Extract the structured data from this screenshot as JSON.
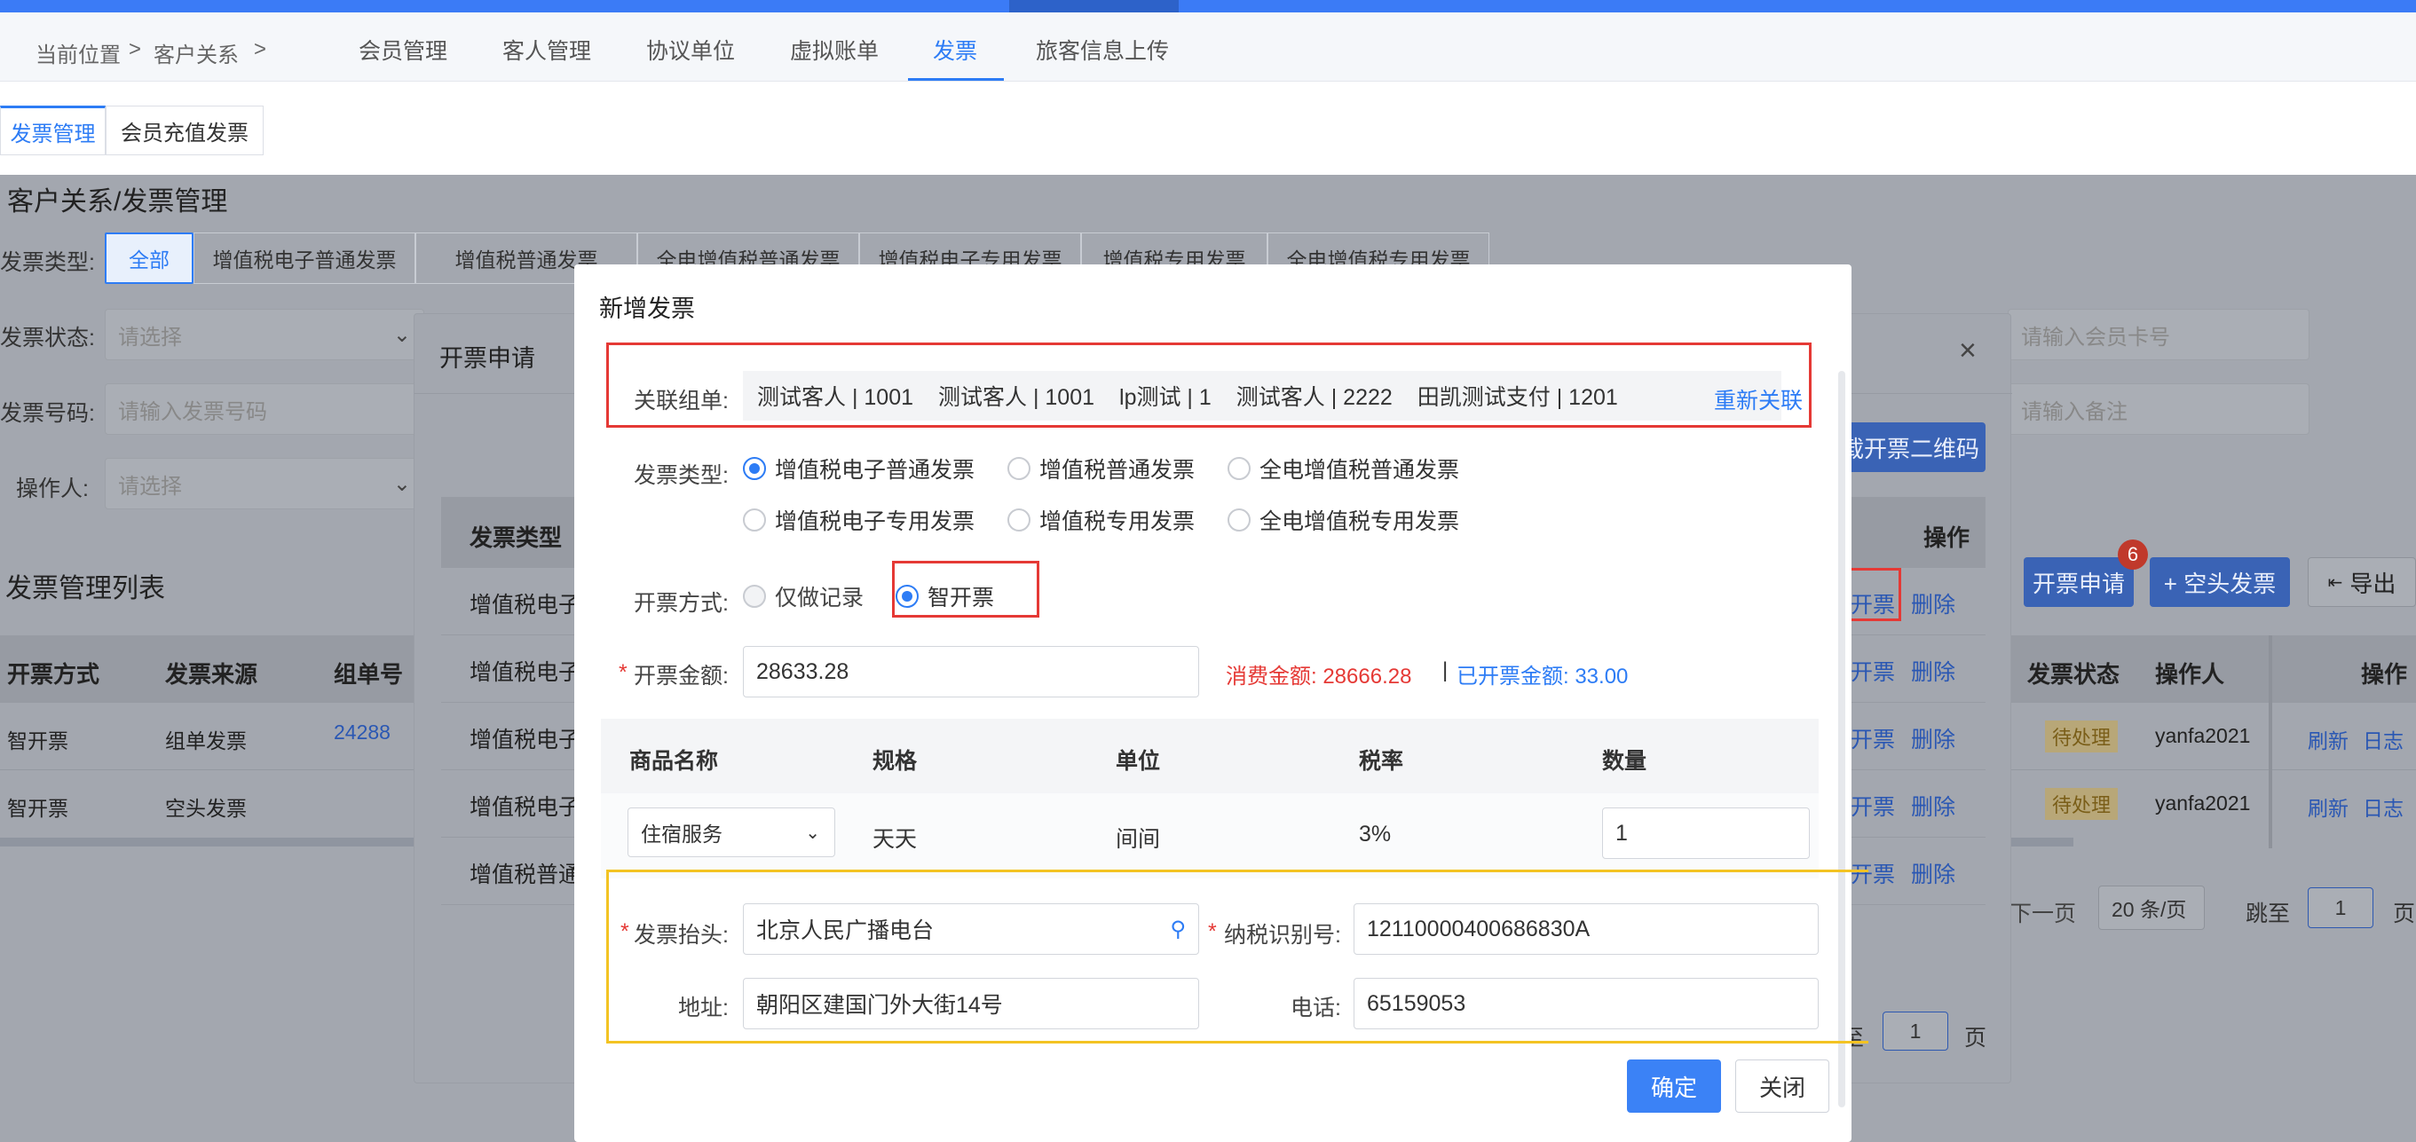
{
  "header": {
    "breadcrumb_current": "当前位置",
    "breadcrumb_sep1": ">",
    "breadcrumb_section": "客户关系",
    "breadcrumb_sep2": ">",
    "tabs": [
      "会员管理",
      "客人管理",
      "协议单位",
      "虚拟账单",
      "发票",
      "旅客信息上传"
    ],
    "active_tab": "发票"
  },
  "subtabs": [
    "发票管理",
    "会员充值发票"
  ],
  "page": {
    "title": "客户关系/发票管理",
    "invoice_type_label": "发票类型:",
    "invoice_type_filters": [
      "全部",
      "增值税电子普通发票",
      "增值税普通发票",
      "全电增值税普通发票",
      "增值税电子专用发票",
      "增值税专用发票",
      "全电增值税专用发票"
    ],
    "status_label": "发票状态:",
    "status_placeholder": "请选择",
    "number_label": "发票号码:",
    "number_placeholder": "请输入发票号码",
    "operator_label": "操作人:",
    "operator_placeholder": "请选择",
    "member_card_placeholder": "请输入会员卡号",
    "remark_placeholder": "请输入备注",
    "list_title": "发票管理列表",
    "apply_button": "开票申请",
    "apply_badge": "6",
    "blank_invoice_button": "+ 空头发票",
    "export_button": "导出",
    "table_headers": [
      "开票方式",
      "发票来源",
      "组单号"
    ],
    "table_headers_right": [
      "发票状态",
      "操作人",
      "操作"
    ],
    "rows": [
      {
        "method": "智开票",
        "source": "组单发票",
        "order_no": "24288",
        "status": "待处理",
        "operator": "yanfa2021",
        "refresh": "刷新",
        "log": "日志"
      },
      {
        "method": "智开票",
        "source": "空头发票",
        "order_no": "",
        "status": "待处理",
        "operator": "yanfa2021",
        "refresh": "刷新",
        "log": "日志"
      }
    ],
    "pagination": {
      "prev": "下一页",
      "page_size": "20 条/页",
      "jump_label": "跳至",
      "jump_value": "1",
      "page_unit": "页"
    }
  },
  "dialog_apply": {
    "title": "开票申请",
    "qr_button": "载开票二维码",
    "col_type": "发票类型",
    "col_action": "操作",
    "rows": [
      {
        "type": "增值税电子",
        "issue": "开票",
        "delete": "删除"
      },
      {
        "type": "增值税电子",
        "issue": "开票",
        "delete": "删除"
      },
      {
        "type": "增值税电子",
        "issue": "开票",
        "delete": "删除"
      },
      {
        "type": "增值税电子",
        "issue": "开票",
        "delete": "删除"
      },
      {
        "type": "增值税普通",
        "issue": "开票",
        "delete": "删除"
      }
    ],
    "pager_jump_prefix": "至",
    "pager_value": "1",
    "pager_unit": "页"
  },
  "modal": {
    "title": "新增发票",
    "linked_order_label": "关联组单:",
    "linked_orders": [
      "测试客人 | 1001",
      "测试客人 | 1001",
      "lp测试 | 1",
      "测试客人 | 2222",
      "田凯测试支付 | 1201"
    ],
    "relink": "重新关联",
    "invoice_type_label": "发票类型:",
    "invoice_types_row1": [
      "增值税电子普通发票",
      "增值税普通发票",
      "全电增值税普通发票"
    ],
    "invoice_types_row2": [
      "增值税电子专用发票",
      "增值税专用发票",
      "全电增值税专用发票"
    ],
    "selected_type": "增值税电子普通发票",
    "method_label": "开票方式:",
    "methods": [
      "仅做记录",
      "智开票"
    ],
    "selected_method": "智开票",
    "amount_required": "*",
    "amount_label": "开票金额:",
    "amount_value": "28633.28",
    "consume_amount": "消费金额: 28666.28",
    "amount_sep": "|",
    "invoiced_amount": "已开票金额: 33.00",
    "goods_headers": [
      "商品名称",
      "规格",
      "单位",
      "税率",
      "数量"
    ],
    "goods_row": {
      "name": "住宿服务",
      "spec": "天天",
      "unit": "间间",
      "tax": "3%",
      "qty": "1"
    },
    "title_required": "*",
    "title_label": "发票抬头:",
    "title_value": "北京人民广播电台",
    "tax_id_required": "*",
    "tax_id_label": "纳税识别号:",
    "tax_id_value": "12110000400686830A",
    "address_label": "地址:",
    "address_value": "朝阳区建国门外大街14号",
    "phone_label": "电话:",
    "phone_value": "65159053",
    "confirm": "确定",
    "close": "关闭"
  },
  "colors": {
    "primary": "#2d7cf5",
    "danger": "#e53935",
    "highlight": "#f3c323",
    "overlay": "#a3a7af"
  }
}
